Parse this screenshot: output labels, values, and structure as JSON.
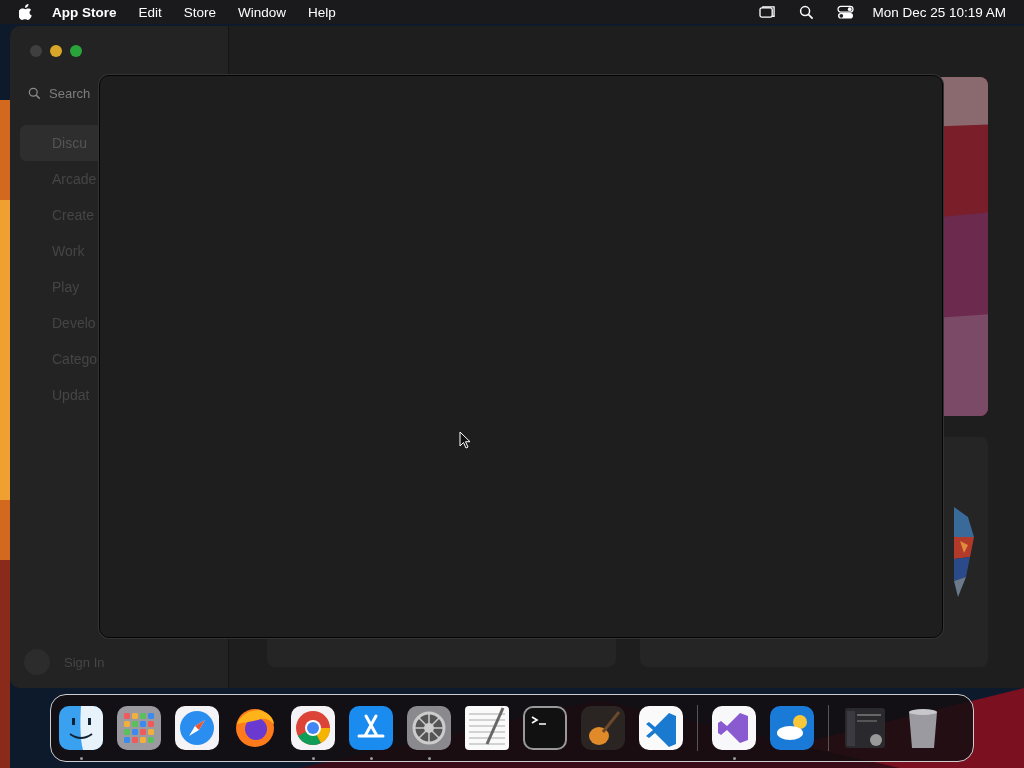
{
  "menu_bar": {
    "app": "App Store",
    "menus": [
      "Edit",
      "Store",
      "Window",
      "Help"
    ],
    "clock": "Mon Dec 25 10:19 AM"
  },
  "window": {
    "traffic_lights": [
      {
        "color": "#3f3f3f"
      },
      {
        "color": "#d9a62a"
      },
      {
        "color": "#2aa33a"
      }
    ],
    "search": {
      "placeholder": "Search"
    },
    "sidebar": [
      {
        "label": "Discu",
        "selected": true
      },
      {
        "label": "Arcade",
        "selected": false
      },
      {
        "label": "Create",
        "selected": false
      },
      {
        "label": "Work",
        "selected": false
      },
      {
        "label": "Play",
        "selected": false
      },
      {
        "label": "Develo",
        "selected": false
      },
      {
        "label": "Catego",
        "selected": false
      },
      {
        "label": "Updat",
        "selected": false
      }
    ],
    "sign_in": "Sign In"
  },
  "dock": {
    "groups": [
      [
        {
          "running": true
        },
        {
          "running": false
        },
        {
          "running": false
        },
        {
          "running": false
        },
        {
          "running": true
        },
        {
          "running": true
        },
        {
          "running": true
        },
        {
          "running": false
        },
        {
          "running": false
        },
        {
          "running": false
        },
        {
          "running": false
        }
      ],
      [
        {
          "running": true
        },
        {
          "running": false
        }
      ],
      [
        {
          "running": false
        },
        {
          "running": false
        }
      ]
    ]
  }
}
